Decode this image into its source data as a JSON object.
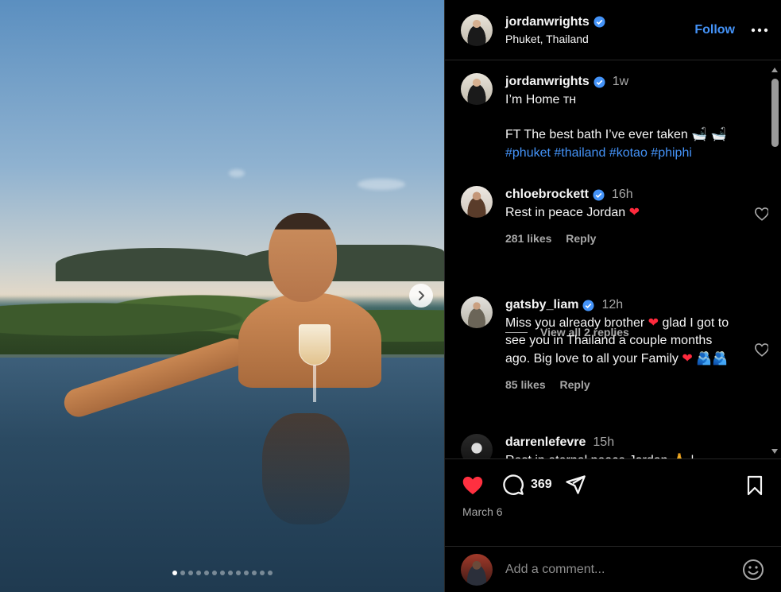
{
  "header": {
    "username": "jordanwrights",
    "location": "Phuket, Thailand",
    "follow_label": "Follow"
  },
  "caption": {
    "username": "jordanwrights",
    "time": "1w",
    "line1": "I’m Home ᴛʜ",
    "line2": "FT The best bath I’ve ever taken 🛁 🛁",
    "hashtags": [
      "#phuket",
      "#thailand",
      "#kotao",
      "#phiphi"
    ]
  },
  "comments": [
    {
      "username": "chloebrockett",
      "time": "16h",
      "text": "Rest in peace Jordan",
      "likes": "281 likes",
      "reply": "Reply"
    },
    {
      "username": "gatsby_liam",
      "time": "12h",
      "text_before": "Miss you already brother",
      "text_after": "glad I got to see you in Thailand a couple months ago. Big love to all your Family",
      "trail": "🫂🫂",
      "likes": "85 likes",
      "reply": "Reply"
    },
    {
      "username": "darrenlefevre",
      "time": "15h",
      "text": "Rest in eternal peace Jordan 🙏 |"
    }
  ],
  "view_replies": "View all 2 replies",
  "actions": {
    "comment_count": "369",
    "date": "March 6",
    "liked": true
  },
  "add_comment": {
    "placeholder": "Add a comment..."
  },
  "carousel": {
    "slide_count": 13,
    "active_index": 0
  },
  "colors": {
    "accent": "#4493f8",
    "like": "#ff3040",
    "background": "#000000"
  },
  "icons": [
    "verified-badge-icon",
    "more-options-icon",
    "chevron-right-icon",
    "heart-icon",
    "comment-icon",
    "share-icon",
    "bookmark-icon",
    "emoji-icon"
  ]
}
